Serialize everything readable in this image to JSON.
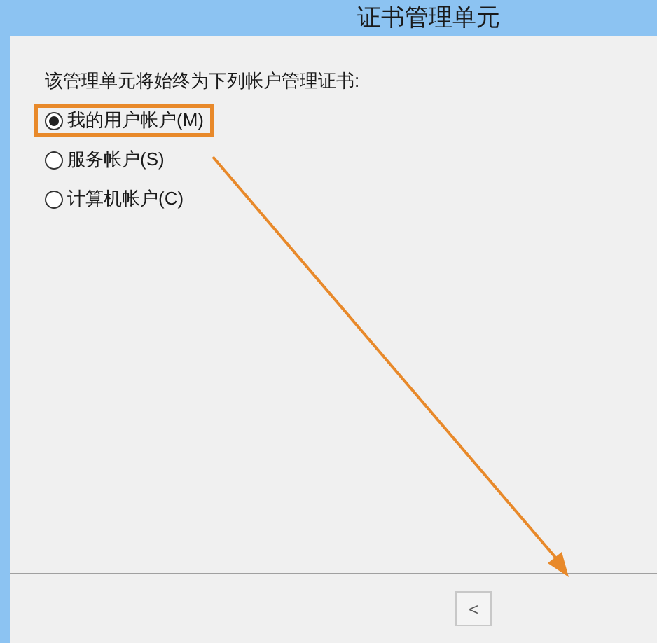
{
  "window": {
    "title": "证书管理单元"
  },
  "prompt": "该管理单元将始终为下列帐户管理证书:",
  "options": [
    {
      "label": "我的用户帐户(M)",
      "selected": true,
      "highlighted": true
    },
    {
      "label": "服务帐户(S)",
      "selected": false,
      "highlighted": false
    },
    {
      "label": "计算机帐户(C)",
      "selected": false,
      "highlighted": false
    }
  ],
  "buttons": [
    {
      "label": "<"
    }
  ]
}
